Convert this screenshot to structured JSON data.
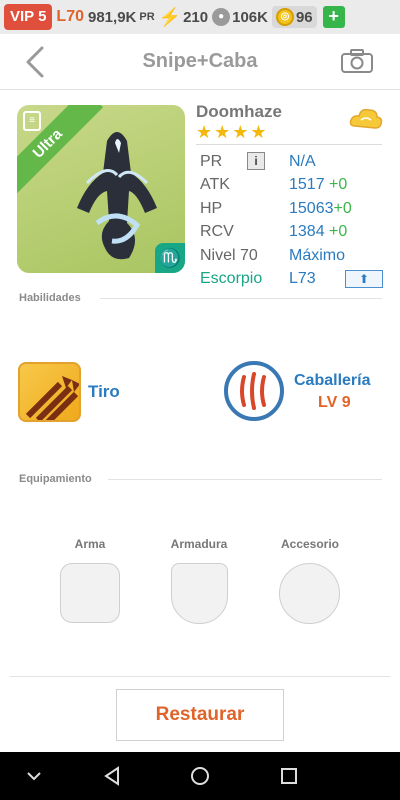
{
  "status_bar": {
    "vip": "VIP 5",
    "level": "L70",
    "power": "981,9K",
    "power_unit": "PR",
    "energy": "210",
    "food": "106K",
    "gems": "96",
    "add_label": "+"
  },
  "header": {
    "title": "Snipe+Caba"
  },
  "hero": {
    "name": "Doomhaze",
    "stars": "★★★★",
    "rarity": "Ultra",
    "stats": [
      {
        "label": "PR",
        "value": "N/A",
        "bonus": ""
      },
      {
        "label": "ATK",
        "value": "1517",
        "bonus": "+0"
      },
      {
        "label": "HP",
        "value": "15063",
        "bonus": "+0"
      },
      {
        "label": "RCV",
        "value": "1384",
        "bonus": "+0"
      },
      {
        "label": "Nivel 70",
        "value": "Máximo",
        "bonus": ""
      },
      {
        "label": "Escorpio",
        "value": "L73",
        "bonus": ""
      }
    ],
    "info_icon_text": "i",
    "zodiac_symbol": "♏"
  },
  "skills": {
    "section_title": "Habilidades",
    "primary": {
      "label": "Tiro"
    },
    "secondary": {
      "label": "Caballería",
      "level": "LV 9"
    }
  },
  "equipment": {
    "section_title": "Equipamiento",
    "slots": [
      {
        "label": "Arma"
      },
      {
        "label": "Armadura"
      },
      {
        "label": "Accesorio"
      }
    ]
  },
  "actions": {
    "restore_label": "Restaurar"
  },
  "colors": {
    "accent_orange": "#e0632a",
    "value_blue": "#2a7bbf",
    "bonus_green": "#3db54a",
    "element_teal": "#17a686"
  },
  "icons": [
    "back-arrow-icon",
    "camera-icon",
    "cloud-icon",
    "info-icon",
    "upgrade-arrow-icon",
    "bolt-icon",
    "paw-icon",
    "coin-icon"
  ]
}
